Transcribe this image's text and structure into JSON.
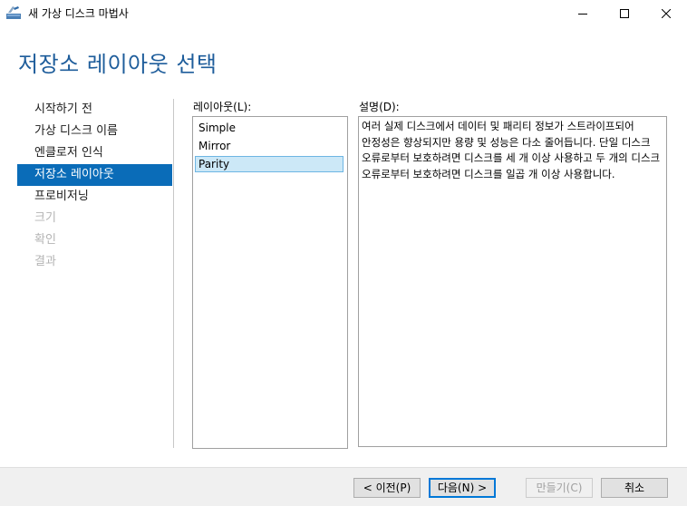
{
  "window": {
    "title": "새 가상 디스크 마법사"
  },
  "page": {
    "heading": "저장소 레이아웃 선택"
  },
  "nav": {
    "items": [
      {
        "label": "시작하기 전",
        "state": "normal"
      },
      {
        "label": "가상 디스크 이름",
        "state": "normal"
      },
      {
        "label": "엔클로저 인식",
        "state": "normal"
      },
      {
        "label": "저장소 레이아웃",
        "state": "selected"
      },
      {
        "label": "프로비저닝",
        "state": "normal"
      },
      {
        "label": "크기",
        "state": "disabled"
      },
      {
        "label": "확인",
        "state": "disabled"
      },
      {
        "label": "결과",
        "state": "disabled"
      }
    ]
  },
  "layout": {
    "label": "레이아웃(L):",
    "options": [
      "Simple",
      "Mirror",
      "Parity"
    ],
    "selected": "Parity"
  },
  "description": {
    "label": "설명(D):",
    "text": "여러 실제 디스크에서 데이터 및 패리티 정보가 스트라이프되어 안정성은 향상되지만 용량 및 성능은 다소 줄어듭니다. 단일 디스크 오류로부터 보호하려면 디스크를 세 개 이상 사용하고 두 개의 디스크 오류로부터 보호하려면 디스크를 일곱 개 이상 사용합니다."
  },
  "footer": {
    "prev": "< 이전(P)",
    "next": "다음(N) >",
    "finish": "만들기(C)",
    "cancel": "취소"
  },
  "colors": {
    "accent": "#0a6cb8",
    "heading": "#1e5d9b",
    "list_selected_bg": "#cce8f7",
    "list_selected_border": "#6eb6e3"
  }
}
